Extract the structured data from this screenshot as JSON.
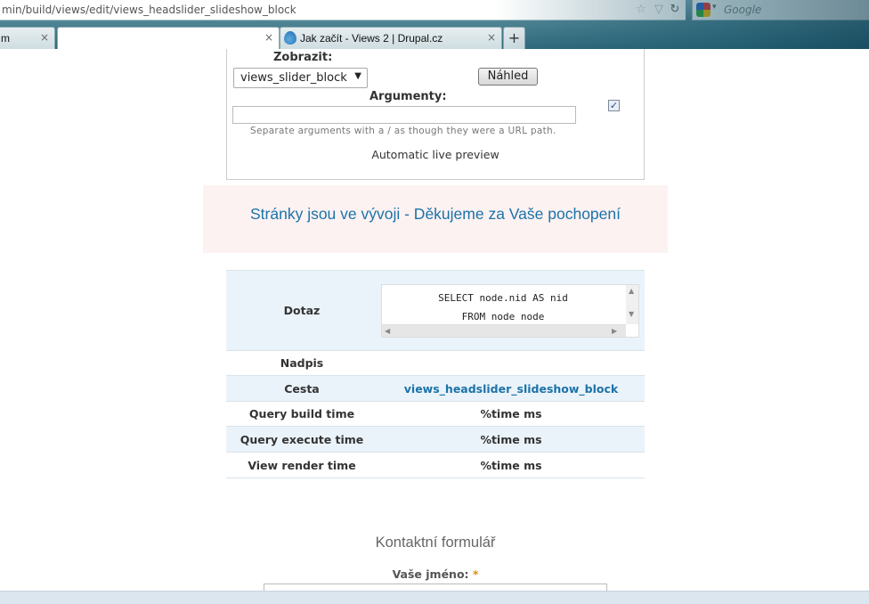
{
  "browser": {
    "url": "min/build/views/edit/views_headslider_slideshow_block",
    "search_placeholder": "Google",
    "tabs": [
      {
        "label": "m",
        "active": false
      },
      {
        "label": "",
        "active": true
      },
      {
        "label": "Jak začít - Views 2 | Drupal.cz",
        "active": false
      }
    ],
    "new_tab": "+",
    "close_glyph": "×"
  },
  "preview": {
    "display_label": "Zobrazit:",
    "display_value": "views_slider_block",
    "preview_button": "Náhled",
    "arguments_label": "Argumenty:",
    "arguments_value": "",
    "arguments_help": "Separate arguments with a / as though they were a URL path.",
    "auto_preview_checked": true,
    "auto_preview_label": "Automatic live preview"
  },
  "banner": {
    "text": "Stránky jsou ve vývoji - Děkujeme za Vaše pochopení",
    "text_color": "#1b73a8",
    "background": "#fdf2f2"
  },
  "info_table": {
    "query_label": "Dotaz",
    "query_lines": [
      "SELECT node.nid AS nid",
      "FROM node node"
    ],
    "rows": [
      {
        "key": "Nadpis",
        "value": ""
      },
      {
        "key": "Cesta",
        "value": "views_headslider_slideshow_block"
      },
      {
        "key": "Query build time",
        "value": "%time ms"
      },
      {
        "key": "Query execute time",
        "value": "%time ms"
      },
      {
        "key": "View render time",
        "value": "%time ms"
      }
    ]
  },
  "contact": {
    "title": "Kontaktní formulář",
    "name_label": "Vaše jméno:",
    "required_mark": "*"
  }
}
